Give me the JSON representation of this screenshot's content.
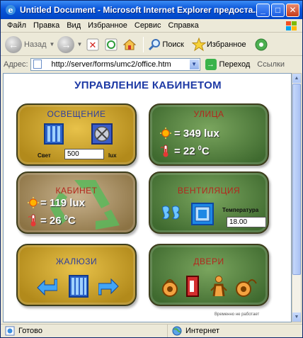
{
  "window": {
    "title": "Untitled Document - Microsoft Internet Explorer предоста..."
  },
  "menu": {
    "items": [
      {
        "label": "Файл"
      },
      {
        "label": "Правка"
      },
      {
        "label": "Вид"
      },
      {
        "label": "Избранное"
      },
      {
        "label": "Сервис"
      },
      {
        "label": "Справка"
      }
    ]
  },
  "toolbar": {
    "back_label": "Назад",
    "search_label": "Поиск",
    "favorites_label": "Избранное"
  },
  "address": {
    "label": "Адрес:",
    "url": "http://server/forms/umc2/office.htm",
    "go_label": "Переход",
    "links_label": "Ссылки"
  },
  "page": {
    "heading": "УПРАВЛЕНИЕ КАБИНЕТОМ",
    "lighting": {
      "title": "ОСВЕЩЕНИЕ",
      "light_label": "Свет",
      "light_value": "500",
      "unit": "lux"
    },
    "street": {
      "title": "УЛИЦА",
      "lux_value": "= 349 lux",
      "temp_value": "= 22",
      "temp_unit": "C",
      "temp_degree": "0"
    },
    "cabinet": {
      "title": "КАБИНЕТ",
      "lux_value": "= 119 lux",
      "temp_value": "= 26",
      "temp_unit": "C",
      "temp_degree": "0"
    },
    "ventilation": {
      "title": "ВЕНТИЛЯЦИЯ",
      "temp_label": "Температура",
      "temp_value": "18.00"
    },
    "blinds": {
      "title": "ЖАЛЮЗИ"
    },
    "doors": {
      "title": "ДВЕРИ"
    },
    "footnote": "Временно не работает"
  },
  "status": {
    "left": "Готово",
    "right": "Интернет"
  },
  "colors": {
    "heading": "#1e3aa5",
    "gold_panel": "#c9a22c",
    "green_panel": "#5a8645",
    "title_red": "#b3271d"
  }
}
